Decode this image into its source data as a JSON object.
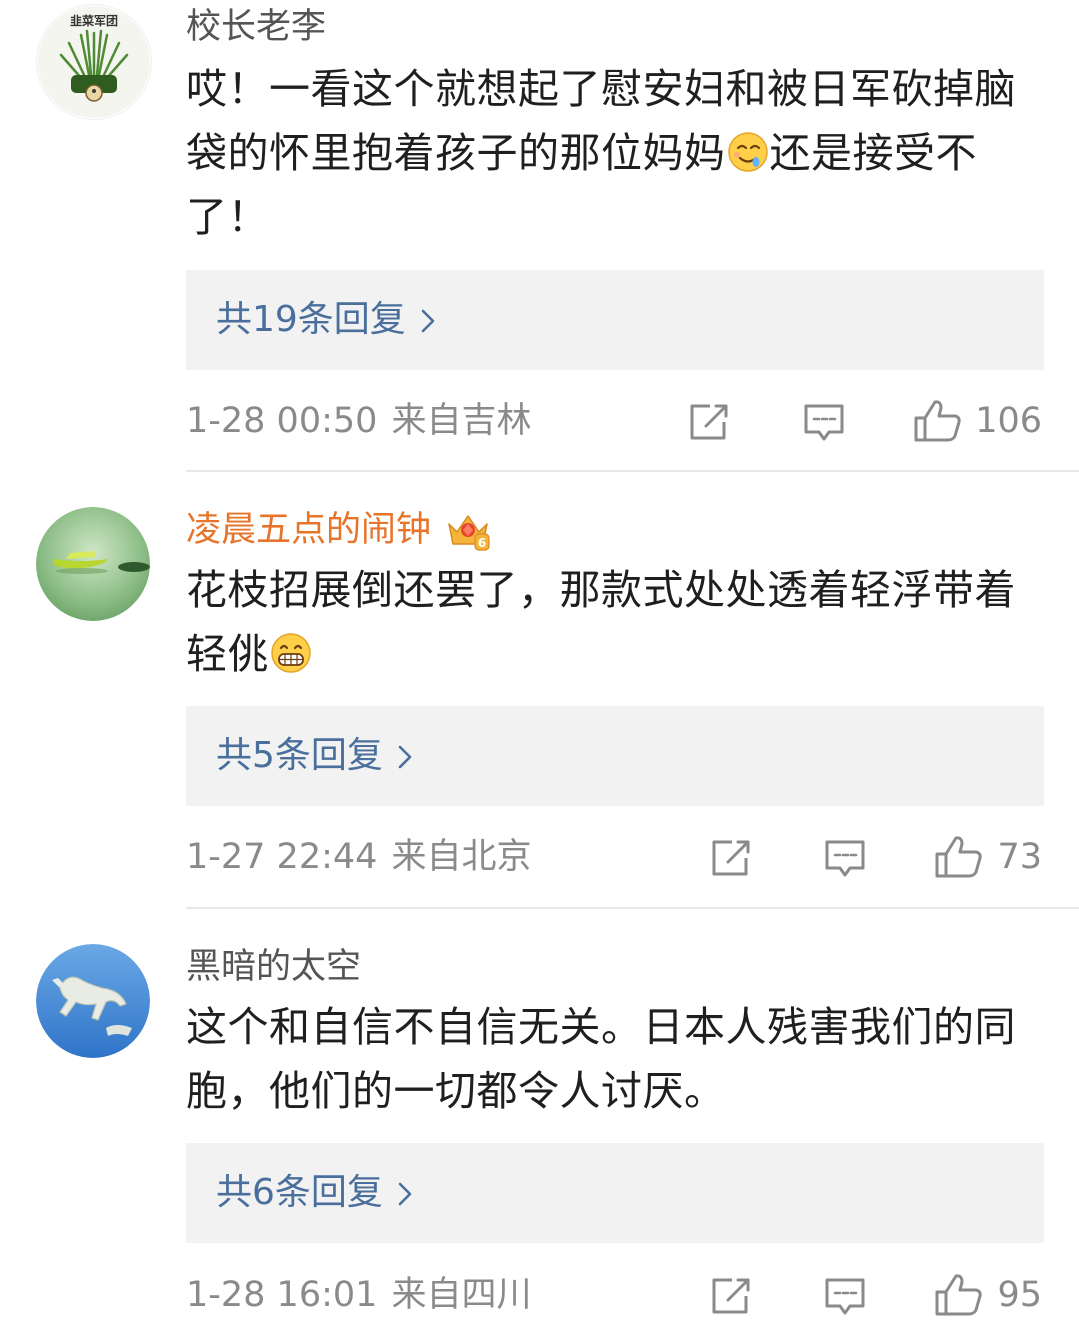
{
  "comments": [
    {
      "username": "校长老李",
      "avatar_text": "韭菜军团",
      "content_before": "哎！一看这个就想起了慰安妇和被日军砍掉脑袋的怀里抱着孩子的那位妈妈",
      "content_after": "还是接受不了！",
      "emoji": "drooling-face-emoji",
      "replies_label": "共19条回复",
      "time": "1-28 00:50",
      "location": "来自吉林",
      "likes": "106"
    },
    {
      "username": "凌晨五点的闹钟",
      "badge": "vip-crown-6-icon",
      "content_before": "花枝招展倒还罢了，那款式处处透着轻浮带着轻佻",
      "content_after": "",
      "emoji": "grinning-face-emoji",
      "replies_label": "共5条回复",
      "time": "1-27 22:44",
      "location": "来自北京",
      "likes": "73"
    },
    {
      "username": "黑暗的太空",
      "content_before": "这个和自信不自信无关。日本人残害我们的同胞，他们的一切都令人讨厌。",
      "content_after": "",
      "replies_label": "共6条回复",
      "time": "1-28 16:01",
      "location": "来自四川",
      "likes": "95"
    }
  ],
  "colors": {
    "link": "#4a6f9d",
    "vip_name": "#e6742a",
    "meta": "#8a8a8a",
    "reply_bg": "#f2f2f2"
  }
}
